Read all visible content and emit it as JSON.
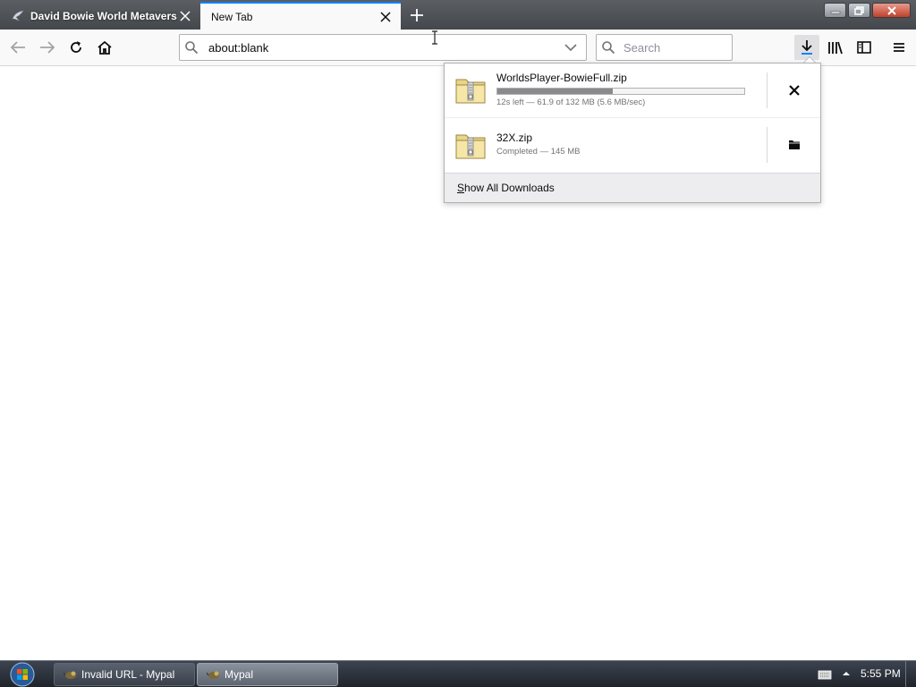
{
  "window": {
    "tabs": [
      {
        "title": "David Bowie World Metaverse",
        "active": false
      },
      {
        "title": "New Tab",
        "active": true
      }
    ]
  },
  "navbar": {
    "url": "about:blank",
    "search_placeholder": "Search"
  },
  "downloads": {
    "items": [
      {
        "filename": "WorldsPlayer-BowieFull.zip",
        "status": "12s left — 61.9 of 132 MB (5.6 MB/sec)",
        "progress_fraction": 0.469,
        "action": "cancel"
      },
      {
        "filename": "32X.zip",
        "status": "Completed — 145 MB",
        "action": "open-folder"
      }
    ],
    "footer_first_letter": "S",
    "footer_rest": "how All Downloads"
  },
  "taskbar": {
    "items": [
      {
        "label": "Invalid URL - Mypal",
        "active": false
      },
      {
        "label": "Mypal",
        "active": true
      }
    ],
    "clock": "5:55 PM"
  },
  "colors": {
    "tab_active_accent": "#0a84ff",
    "toolbar_bg": "#f9f9fa",
    "panel_footer_bg": "#ededf0",
    "progress_fill": "#8a8a8c"
  }
}
